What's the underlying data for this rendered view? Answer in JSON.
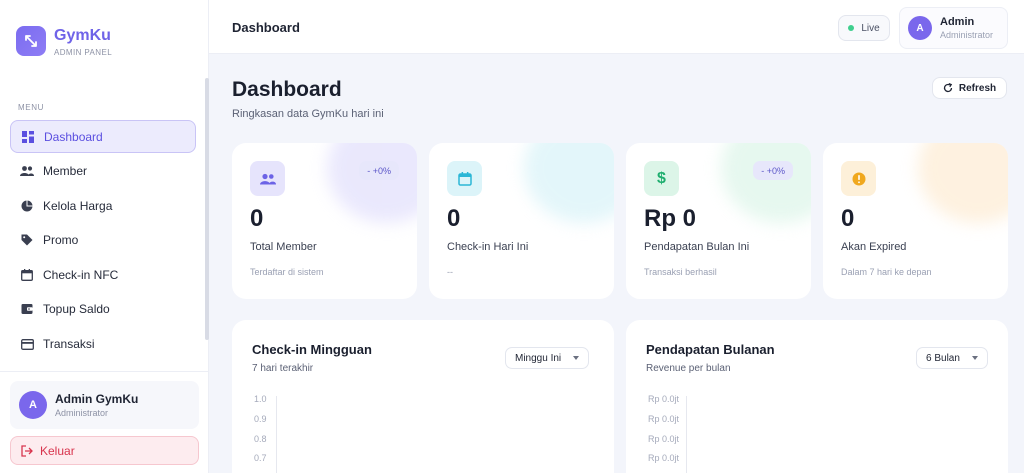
{
  "brand": {
    "name": "GymKu",
    "subtitle": "ADMIN PANEL"
  },
  "sidebar": {
    "menu_label": "MENU",
    "items": [
      {
        "label": "Dashboard",
        "icon": "grid-icon",
        "active": true
      },
      {
        "label": "Member",
        "icon": "users-icon",
        "active": false
      },
      {
        "label": "Kelola Harga",
        "icon": "pie-icon",
        "active": false
      },
      {
        "label": "Promo",
        "icon": "tag-icon",
        "active": false
      },
      {
        "label": "Check-in NFC",
        "icon": "calendar-icon",
        "active": false
      },
      {
        "label": "Topup Saldo",
        "icon": "wallet-icon",
        "active": false
      },
      {
        "label": "Transaksi",
        "icon": "card-icon",
        "active": false
      }
    ],
    "user": {
      "initial": "A",
      "name": "Admin GymKu",
      "role": "Administrator"
    },
    "logout_label": "Keluar"
  },
  "header": {
    "title": "Dashboard",
    "live_label": "Live",
    "user": {
      "initial": "A",
      "name": "Admin",
      "role": "Administrator"
    }
  },
  "main": {
    "title": "Dashboard",
    "subtitle": "Ringkasan data GymKu hari ini",
    "refresh_label": "Refresh",
    "stats": [
      {
        "value": "0",
        "label": "Total Member",
        "hint": "Terdaftar di sistem",
        "badge": "- +0%",
        "icon": "users-icon",
        "color": "#6c63e6"
      },
      {
        "value": "0",
        "label": "Check-in Hari Ini",
        "hint": "--",
        "badge": "",
        "icon": "calendar-icon",
        "color": "#2bb6d6"
      },
      {
        "value": "Rp 0",
        "label": "Pendapatan Bulan Ini",
        "hint": "Transaksi berhasil",
        "badge": "- +0%",
        "icon": "dollar-icon",
        "color": "#1fae6f"
      },
      {
        "value": "0",
        "label": "Akan Expired",
        "hint": "Dalam 7 hari ke depan",
        "badge": "",
        "icon": "warning-icon",
        "color": "#f0a81e"
      }
    ],
    "weekly": {
      "title": "Check-in Mingguan",
      "subtitle": "7 hari terakhir",
      "select_value": "Minggu Ini",
      "ticks": [
        "1.0",
        "0.9",
        "0.8",
        "0.7"
      ]
    },
    "monthly": {
      "title": "Pendapatan Bulanan",
      "subtitle": "Revenue per bulan",
      "select_value": "6 Bulan",
      "ticks": [
        "Rp 0.0jt",
        "Rp 0.0jt",
        "Rp 0.0jt",
        "Rp 0.0jt"
      ]
    }
  }
}
